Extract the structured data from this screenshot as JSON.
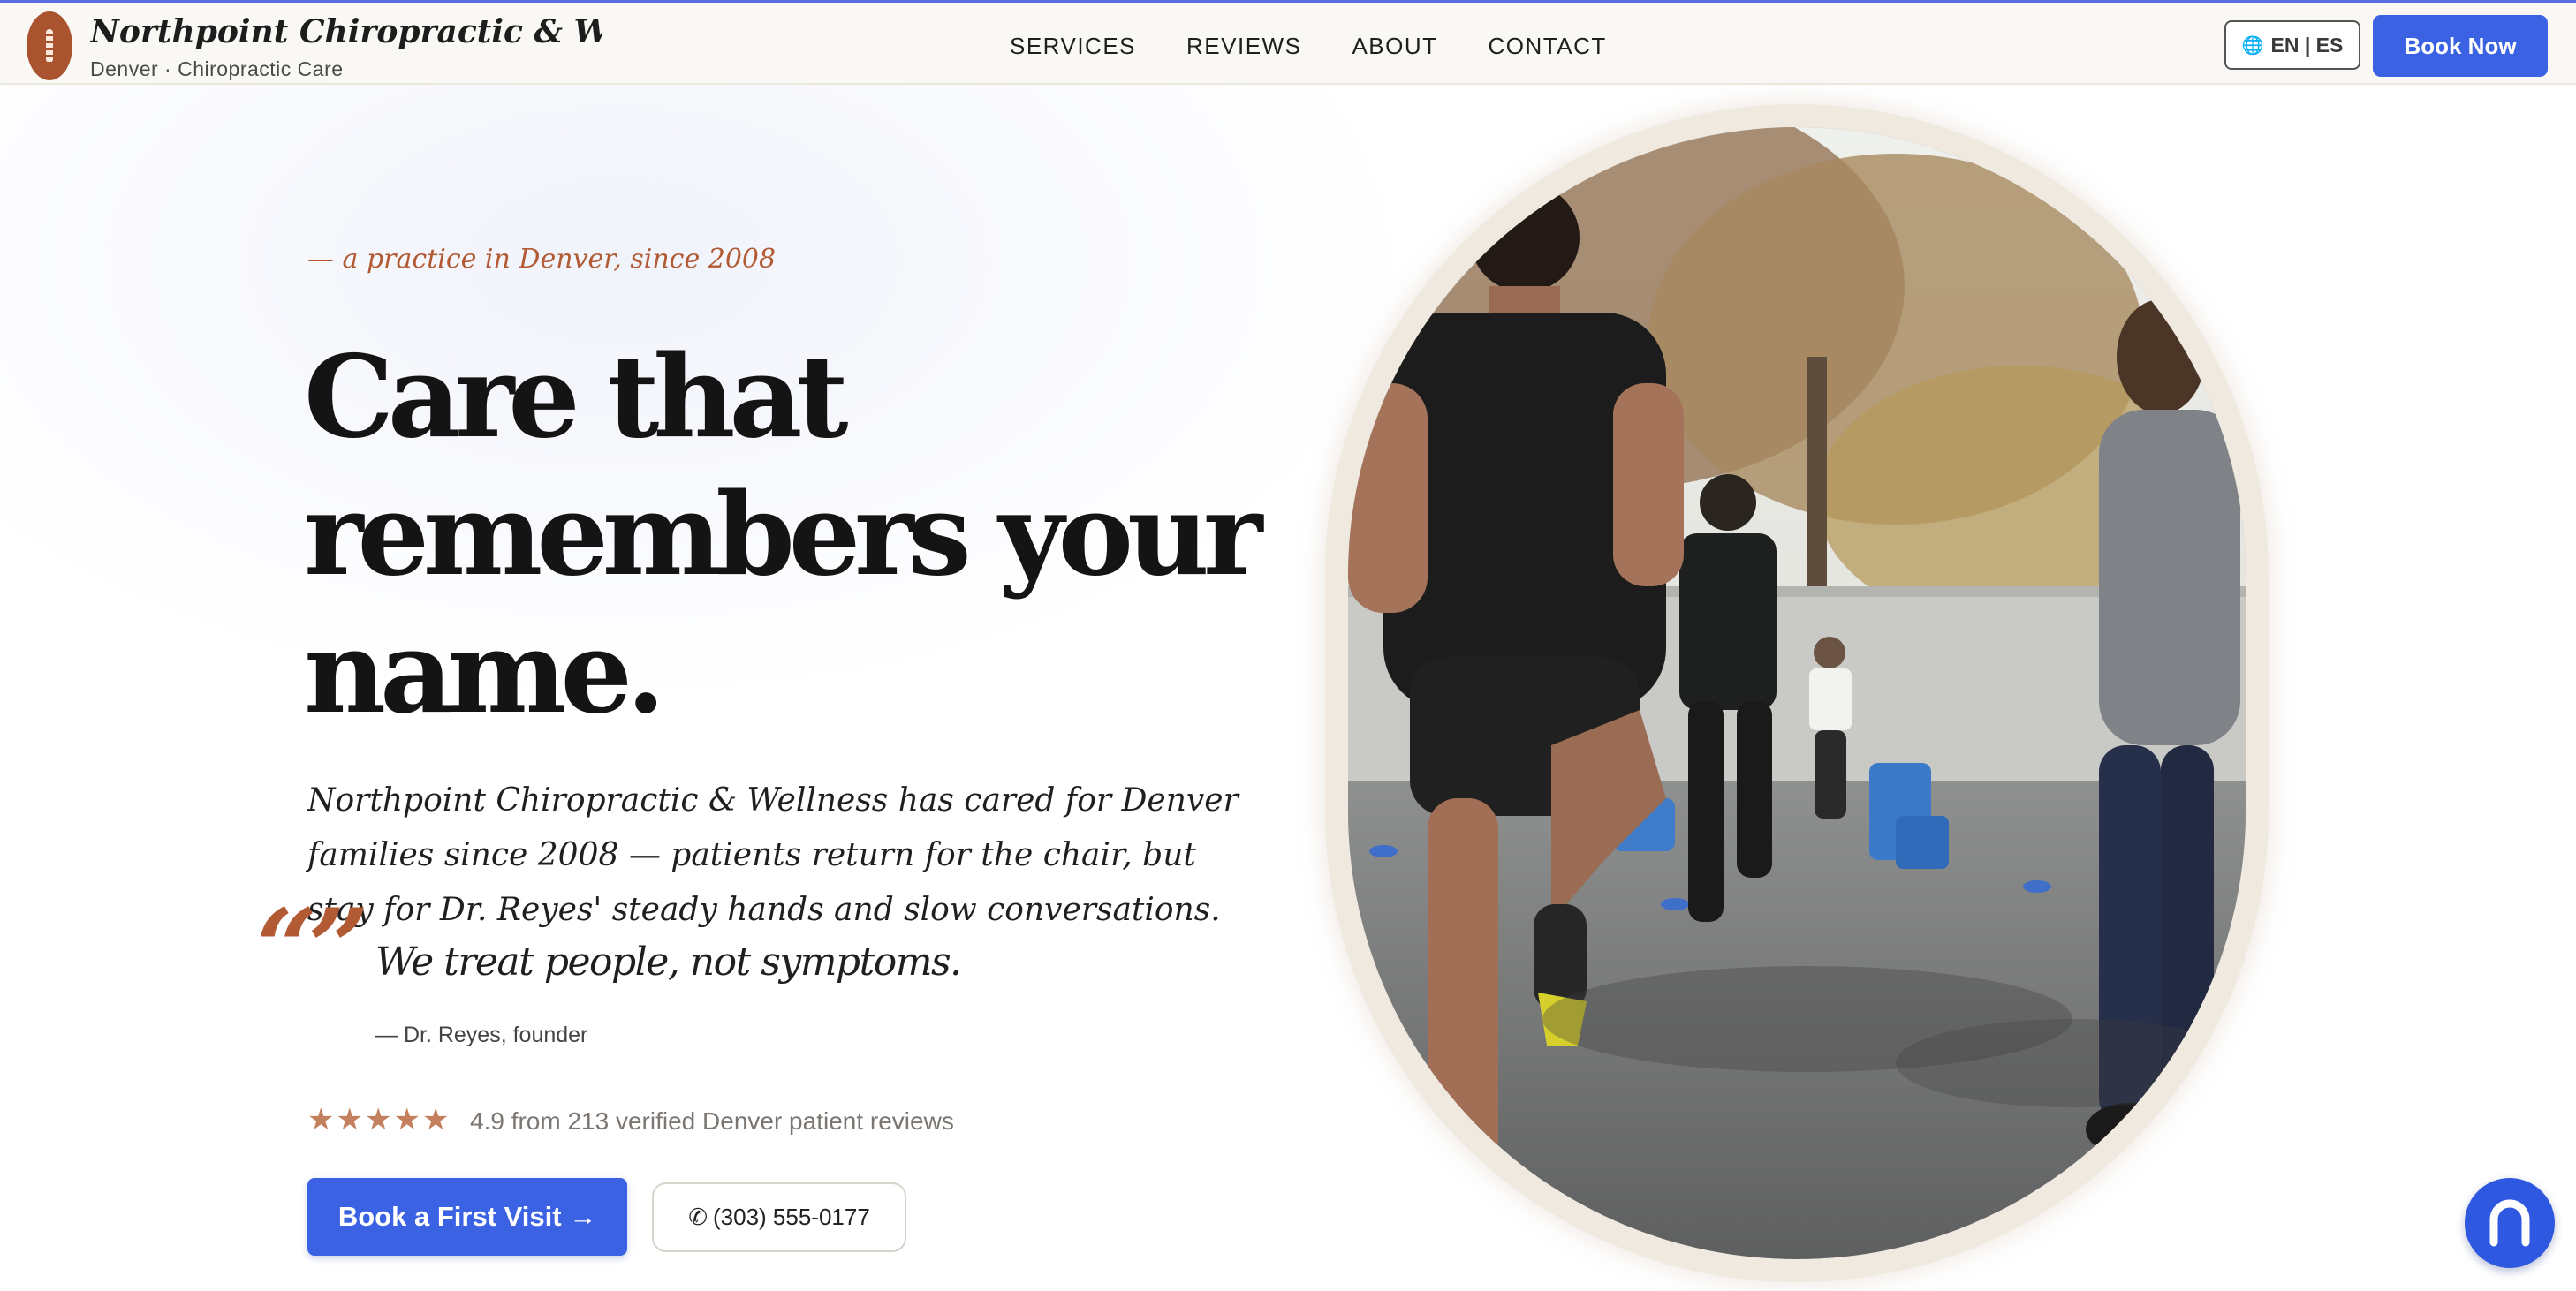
{
  "header": {
    "brand_name": "Northpoint Chiropractic & Wellne",
    "brand_sub": "Denver · Chiropractic Care",
    "nav": [
      "SERVICES",
      "REVIEWS",
      "ABOUT",
      "CONTACT"
    ],
    "lang_label": "EN | ES",
    "book_label": "Book Now"
  },
  "hero": {
    "eyebrow": "— a practice in Denver, since 2008",
    "headline_lines": [
      "Care that",
      "remembers your",
      "name."
    ],
    "intro": "Northpoint Chiropractic & Wellness has cared for Denver families since 2008 — patients return for the chair, but stay for Dr. Reyes' steady hands and slow conversations.",
    "quote_mark": "“”",
    "quote": "We treat people, not symptoms.",
    "quote_author": "— Dr. Reyes, founder",
    "rating_stars": 5,
    "rating_text": "4.9 from 213 verified Denver patient reviews",
    "cta_primary": "Book a First Visit →",
    "cta_phone": "(303) 555-0177"
  },
  "colors": {
    "accent_blue": "#3a62e3",
    "accent_rust": "#b25a34",
    "star": "#c4805e"
  },
  "icons": [
    "spine-logo-icon",
    "globe-icon",
    "star-icon",
    "phone-icon",
    "chat-widget-icon"
  ]
}
